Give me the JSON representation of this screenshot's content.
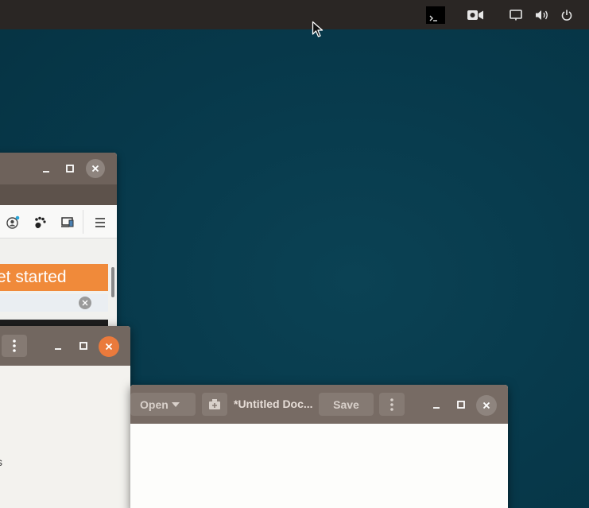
{
  "top_panel": {
    "icons": [
      "terminal-icon",
      "screen-recorder-icon",
      "display-icon",
      "volume-icon",
      "power-icon"
    ]
  },
  "browser_window": {
    "banner_text": "et started",
    "toolbar_icons": [
      "account-icon",
      "gnome-foot-icon",
      "device-icon",
      "hamburger-menu-icon"
    ]
  },
  "middle_window": {
    "body_text": "s"
  },
  "editor_window": {
    "open_label": "Open",
    "doc_title": "*Untitled Doc...",
    "save_label": "Save"
  },
  "colors": {
    "desktop": "#07394b",
    "panel": "#2a2624",
    "titlebar": "#776b64",
    "accent_orange": "#f08a3a",
    "close_active": "#ea7a3c"
  }
}
